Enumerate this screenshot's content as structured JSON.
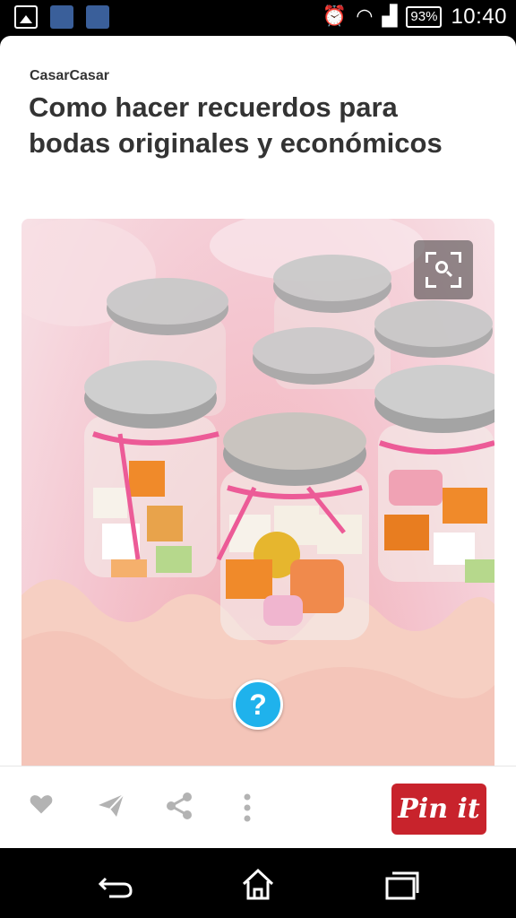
{
  "status_bar": {
    "battery": "93%",
    "time": "10:40"
  },
  "pin": {
    "source": "CasarCasar",
    "title": "Como hacer recuerdos para bodas originales y económicos",
    "help_label": "?"
  },
  "actions": {
    "pin_it_label": "Pin it",
    "icons": [
      "heart-icon",
      "send-icon",
      "share-icon",
      "more-icon"
    ]
  },
  "colors": {
    "pin_red": "#c8232c",
    "help_blue": "#1fb2ec",
    "title_text": "#333333"
  }
}
